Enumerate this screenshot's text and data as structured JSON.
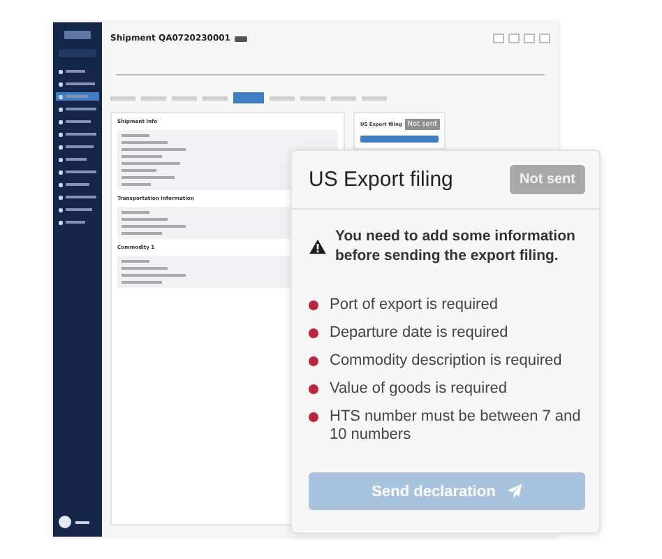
{
  "app": {
    "title": "Shipment QA0720230001",
    "sidebar_items": [
      {
        "selected": false
      },
      {
        "selected": false
      },
      {
        "selected": true
      },
      {
        "selected": false
      },
      {
        "selected": false
      },
      {
        "selected": false
      },
      {
        "selected": false
      },
      {
        "selected": false
      },
      {
        "selected": false
      },
      {
        "selected": false
      },
      {
        "selected": false
      },
      {
        "selected": false
      },
      {
        "selected": false
      }
    ],
    "tabs": [
      {
        "selected": false
      },
      {
        "selected": false
      },
      {
        "selected": false
      },
      {
        "selected": false
      },
      {
        "selected": true
      },
      {
        "selected": false
      },
      {
        "selected": false
      },
      {
        "selected": false
      },
      {
        "selected": false
      }
    ],
    "sections": [
      {
        "title": "Shipment Info"
      },
      {
        "title": "Transportation information"
      },
      {
        "title": "Commodity 1"
      }
    ],
    "side_panel": {
      "title": "US Export filing",
      "status": "Not sent"
    }
  },
  "export_filing": {
    "title": "US Export filing",
    "status": "Not sent",
    "warning": "You need to add some information before sending the export filing.",
    "errors": [
      {
        "text": "Port of export is required"
      },
      {
        "text": "Departure date is required"
      },
      {
        "text": "Commodity description is required"
      },
      {
        "text": "Value of goods is required"
      },
      {
        "text": "HTS number must be between 7 and 10 numbers"
      }
    ],
    "button": {
      "label": "Send declaration",
      "disabled": true
    }
  }
}
